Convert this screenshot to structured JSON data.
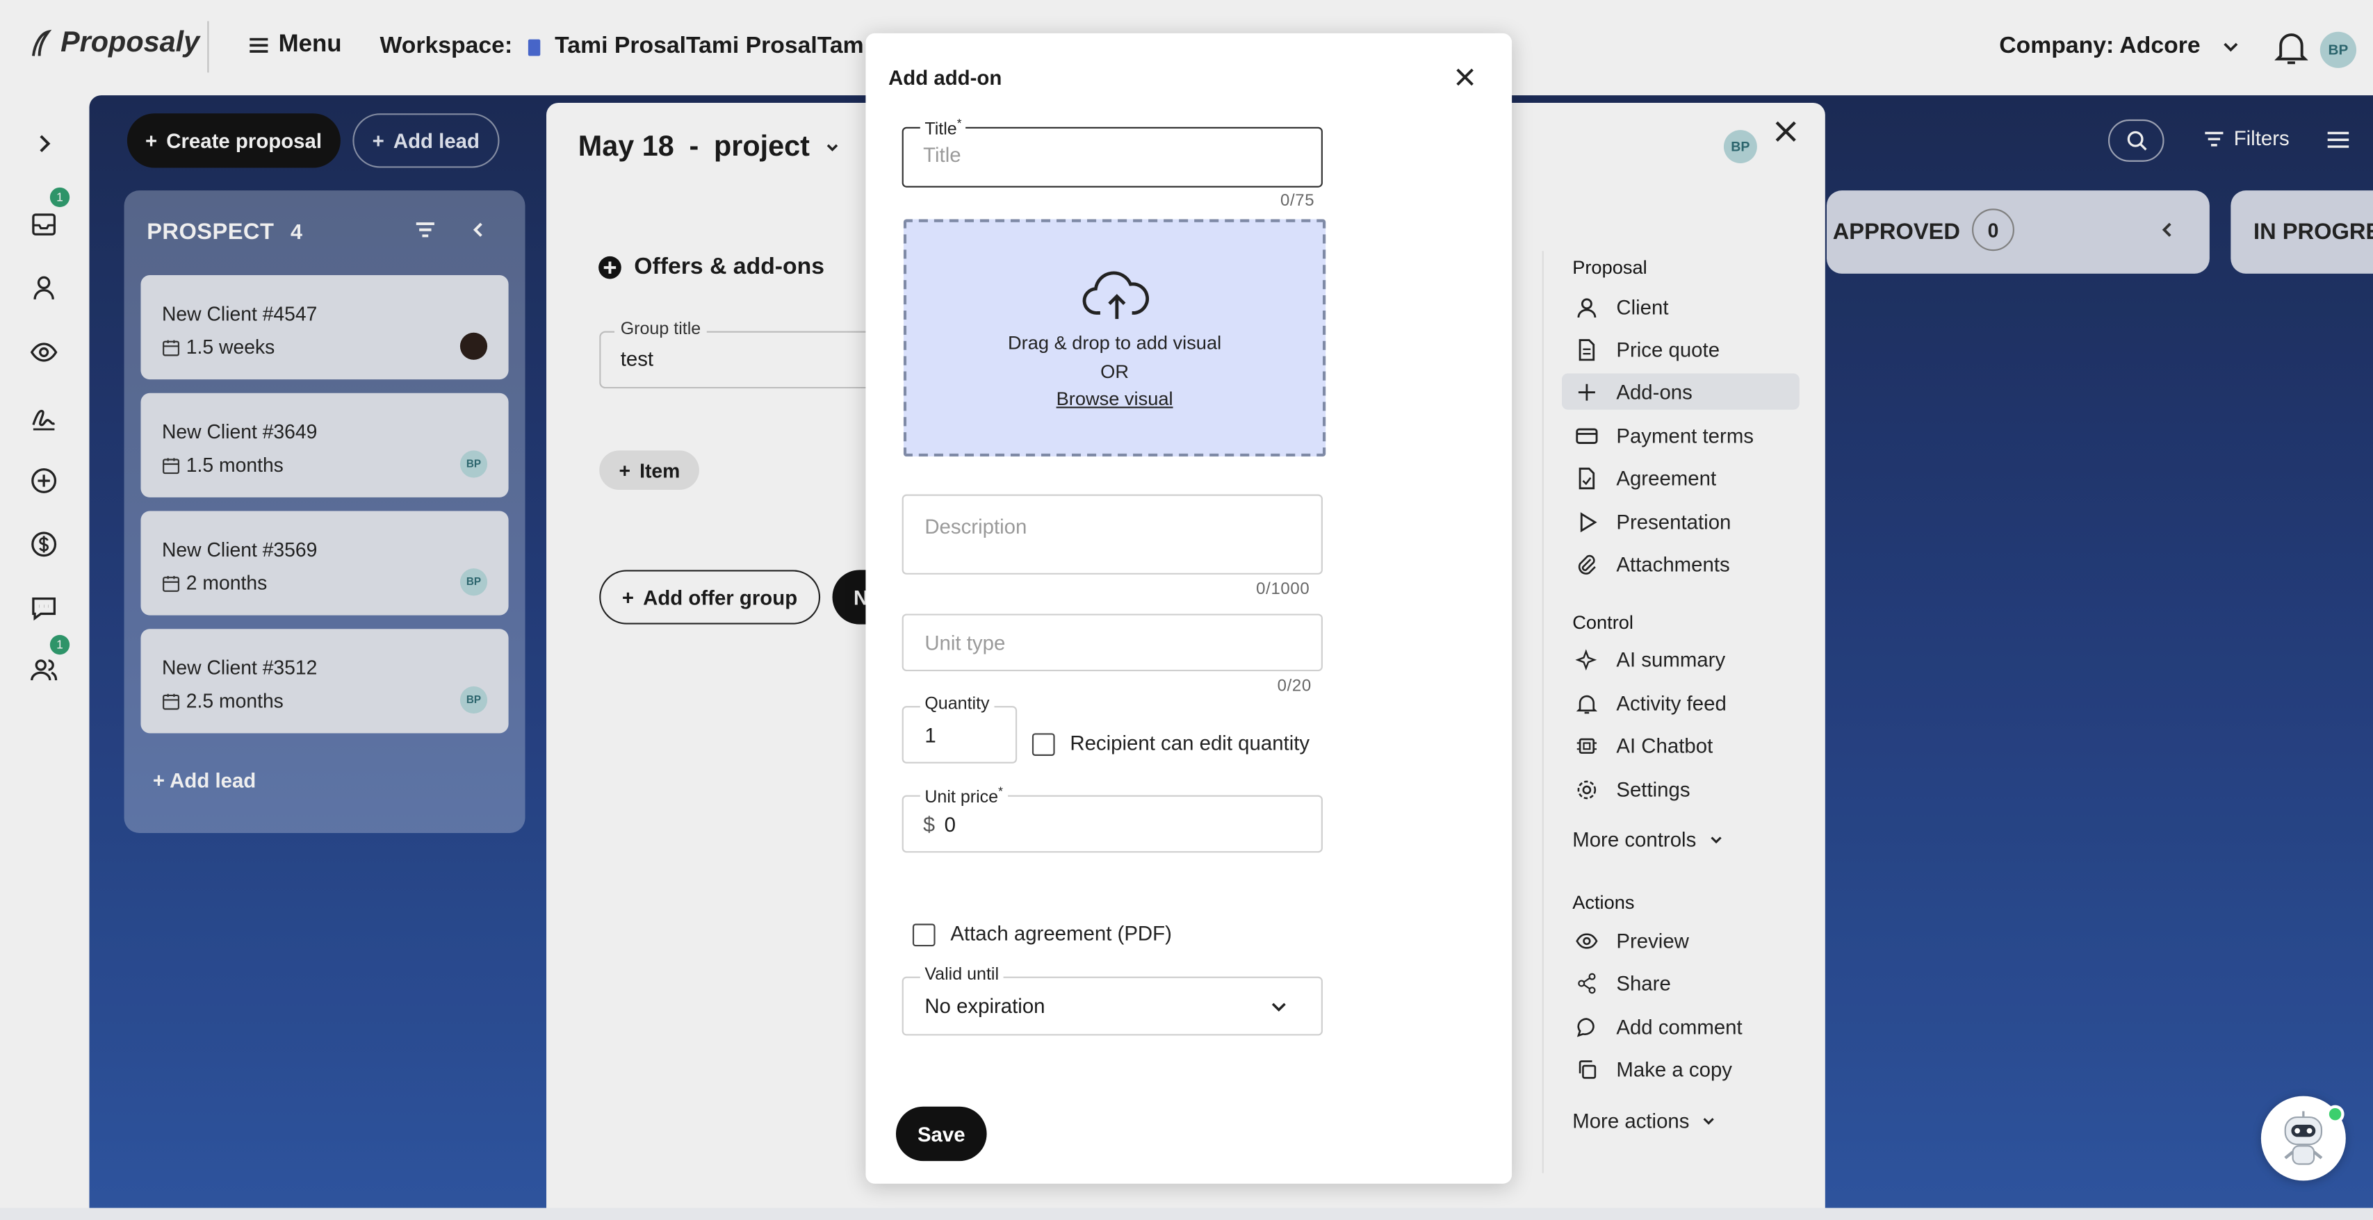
{
  "app": {
    "logo_text": "Proposaly",
    "menu_label": "Menu"
  },
  "header": {
    "workspace_label": "Workspace:",
    "workspace_name": "Tami ProsalTami ProsalTam",
    "company_label": "Company: Adcore",
    "user_initials": "BP"
  },
  "rail": {
    "badges": [
      "1",
      "1"
    ]
  },
  "board": {
    "create_proposal": "Create proposal",
    "add_lead": "Add lead",
    "filters_label": "Filters",
    "prospect": {
      "title": "PROSPECT",
      "count": "4",
      "cards": [
        {
          "name": "New Client #4547",
          "duration": "1.5 weeks",
          "avatar": ""
        },
        {
          "name": "New Client #3649",
          "duration": "1.5 months",
          "avatar": "BP"
        },
        {
          "name": "New Client #3569",
          "duration": "2 months",
          "avatar": "BP"
        },
        {
          "name": "New Client #3512",
          "duration": "2.5 months",
          "avatar": "BP"
        }
      ],
      "add_lead": "+ Add lead"
    },
    "approved": {
      "title": "APPROVED",
      "count": "0"
    },
    "in_progress": {
      "title": "IN PROGRE"
    }
  },
  "panel": {
    "date": "May 18",
    "dash": "-",
    "project": "project",
    "avatar": "BP",
    "offers_title": "Offers & add-ons",
    "group_title_label": "Group title",
    "group_title_value": "test",
    "item_button": "Item",
    "add_offer_group": "Add offer group",
    "dark_button_letter": "N",
    "nav": {
      "proposal_head": "Proposal",
      "proposal_items": [
        "Client",
        "Price quote",
        "Add-ons",
        "Payment terms",
        "Agreement",
        "Presentation",
        "Attachments"
      ],
      "active_item": "Add-ons",
      "control_head": "Control",
      "control_items": [
        "AI summary",
        "Activity feed",
        "AI Chatbot",
        "Settings"
      ],
      "more_controls": "More controls",
      "actions_head": "Actions",
      "action_items": [
        "Preview",
        "Share",
        "Add comment",
        "Make a copy"
      ],
      "more_actions": "More actions"
    }
  },
  "modal": {
    "title": "Add add-on",
    "title_field": {
      "label": "Title",
      "required_mark": "*",
      "placeholder": "Title",
      "counter": "0/75"
    },
    "upload": {
      "line1": "Drag & drop to add visual",
      "line2": "OR",
      "line3": "Browse visual"
    },
    "description": {
      "placeholder": "Description",
      "counter": "0/1000"
    },
    "unit_type": {
      "placeholder": "Unit type",
      "counter": "0/20"
    },
    "quantity": {
      "label": "Quantity",
      "value": "1"
    },
    "recipient_edit": "Recipient can edit quantity",
    "unit_price": {
      "label": "Unit price",
      "required_mark": "*",
      "currency": "$",
      "value": "0"
    },
    "attach_agreement": "Attach agreement (PDF)",
    "valid_until": {
      "label": "Valid until",
      "value": "No expiration"
    },
    "save": "Save"
  }
}
